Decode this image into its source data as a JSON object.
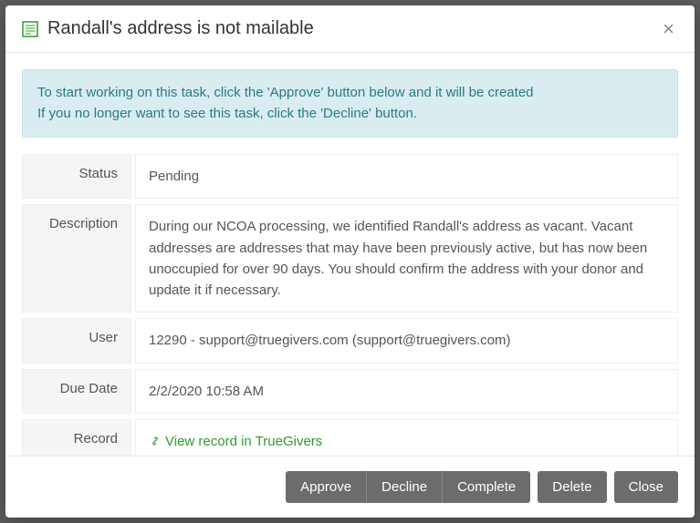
{
  "modal": {
    "title": "Randall's address is not mailable",
    "info_line1": "To start working on this task, click the 'Approve' button below and it will be created",
    "info_line2": "If you no longer want to see this task, click the 'Decline' button."
  },
  "fields": {
    "status_label": "Status",
    "status_value": "Pending",
    "description_label": "Description",
    "description_value": "During our NCOA processing, we identified Randall's address as vacant. Vacant addresses are addresses that may have been previously active, but has now been unoccupied for over 90 days. You should confirm the address with your donor and update it if necessary.",
    "user_label": "User",
    "user_value": "12290 - support@truegivers.com (support@truegivers.com)",
    "due_date_label": "Due Date",
    "due_date_value": "2/2/2020 10:58 AM",
    "record_label": "Record",
    "record_link_text": "View record in TrueGivers"
  },
  "footer": {
    "approve": "Approve",
    "decline": "Decline",
    "complete": "Complete",
    "delete": "Delete",
    "close": "Close"
  }
}
